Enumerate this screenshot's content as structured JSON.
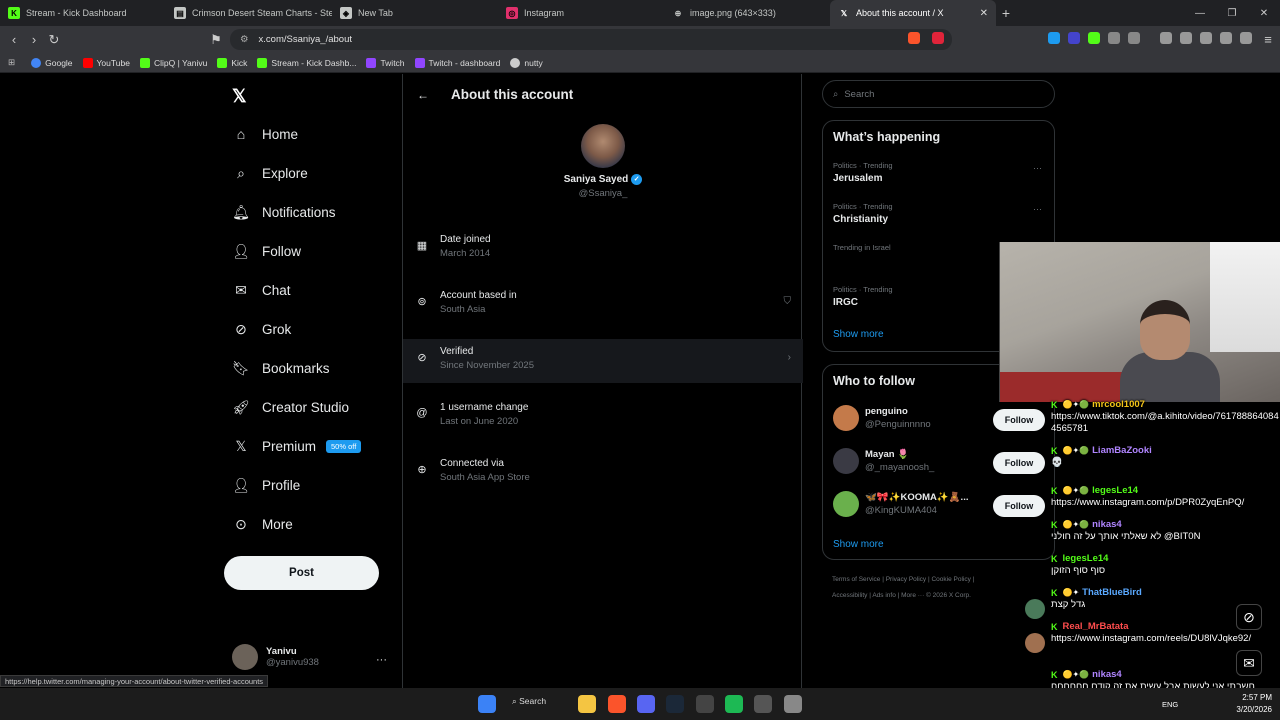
{
  "browser": {
    "tabs": [
      {
        "title": "Stream - Kick Dashboard",
        "color": "#53fc18"
      },
      {
        "title": "Crimson Desert Steam Charts - Steam",
        "color": "#c4c7c5"
      },
      {
        "title": "New Tab",
        "color": "#c4c7c5"
      },
      {
        "title": "Instagram",
        "color": "#e1306c"
      },
      {
        "title": "image.png (643×333)",
        "color": "#c4c7c5"
      },
      {
        "title": "About this account / X",
        "color": "#ffffff"
      }
    ],
    "url": "x.com/Ssaniya_/about",
    "bookmarks": [
      "Google",
      "YouTube",
      "ClipQ | Yanivu",
      "Kick",
      "Stream - Kick Dashb...",
      "Twitch",
      "Twitch - dashboard",
      "nutty"
    ],
    "status_url": "https://help.twitter.com/managing-your-account/about-twitter-verified-accounts"
  },
  "nav": {
    "items": [
      "Home",
      "Explore",
      "Notifications",
      "Follow",
      "Chat",
      "Grok",
      "Bookmarks",
      "Creator Studio",
      "Premium",
      "Profile",
      "More"
    ],
    "premium_badge": "50% off",
    "post_label": "Post",
    "user_name": "Yanivu",
    "user_handle": "@yanivu938"
  },
  "main": {
    "title": "About this account",
    "name": "Saniya Sayed",
    "handle": "@Ssaniya_",
    "rows": [
      {
        "title": "Date joined",
        "sub": "March 2014"
      },
      {
        "title": "Account based in",
        "sub": "South Asia"
      },
      {
        "title": "Verified",
        "sub": "Since November 2025"
      },
      {
        "title": "1 username change",
        "sub": "Last on June 2020"
      },
      {
        "title": "Connected via",
        "sub": "South Asia App Store"
      }
    ]
  },
  "sidebar": {
    "search_placeholder": "Search",
    "happening_title": "What’s happening",
    "trends": [
      {
        "cat": "Politics · Trending",
        "name": "Jerusalem"
      },
      {
        "cat": "Politics · Trending",
        "name": "Christianity"
      },
      {
        "cat": "Trending in Israel",
        "name": ""
      },
      {
        "cat": "Politics · Trending",
        "name": "IRGC"
      }
    ],
    "show_more": "Show more",
    "follow_title": "Who to follow",
    "follow": [
      {
        "name": "penguino",
        "handle": "@Penguinnnno"
      },
      {
        "name": "Mayan 🌷",
        "handle": "@_mayanoosh_"
      },
      {
        "name": "🦋🎀✨KOOMA✨🧸...",
        "handle": "@KingKUMA404"
      }
    ],
    "follow_btn": "Follow",
    "footer1": "Terms of Service  |  Privacy Policy  |  Cookie Policy  |",
    "footer2": "Accessibility  |  Ads info  |  More ···  © 2026 X Corp."
  },
  "chat": [
    {
      "user": "mrcool1007",
      "color": "#f5c518",
      "text": "https://www.tiktok.com/@a.kihito/video/7617888640844565781"
    },
    {
      "user": "LiamBaZooki",
      "color": "#b085ff",
      "text": "💀"
    },
    {
      "user": "legesLe14",
      "color": "#53fc18",
      "text": "https://www.instagram.com/p/DPR0ZyqEnPQ/"
    },
    {
      "user": "nikas4",
      "color": "#b085ff",
      "text": "לא שאלתי אותך על זה חולני @BIT0N"
    },
    {
      "user": "legesLe14",
      "color": "#53fc18",
      "text": "סוף סוף הזוקן"
    },
    {
      "user": "ThatBlueBird",
      "color": "#5aa9ff",
      "text": "גדל קצת"
    },
    {
      "user": "Real_MrBatata",
      "color": "#ff4d4d",
      "text": "https://www.instagram.com/reels/DU8lVJqke92/"
    },
    {
      "user": "nikas4",
      "color": "#b085ff",
      "text": "חשבתי אני לעשות אבל עשית את זה קודם חחחחחח"
    }
  ],
  "taskbar": {
    "search": "Search",
    "lang": "ENG",
    "time": "2:57 PM",
    "date": "3/20/2026"
  }
}
